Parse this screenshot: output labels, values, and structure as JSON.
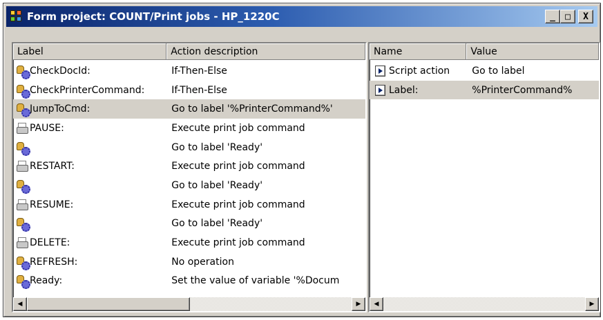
{
  "window": {
    "title": "Form project: COUNT/Print jobs - HP_1220C",
    "minimize_label": "_",
    "restore_label": "□",
    "close_label": "X"
  },
  "left_table": {
    "columns": [
      "Label",
      "Action description"
    ],
    "rows": [
      {
        "icon": "gear-person-icon",
        "label": "CheckDocId:",
        "action": "If-Then-Else"
      },
      {
        "icon": "gear-person-icon",
        "label": "CheckPrinterCommand:",
        "action": "If-Then-Else"
      },
      {
        "icon": "gear-person-icon",
        "label": "JumpToCmd:",
        "action": "Go to label '%PrinterCommand%'",
        "selected": true
      },
      {
        "icon": "printer-icon",
        "label": "PAUSE:",
        "action": "Execute print job command"
      },
      {
        "icon": "gear-person-icon",
        "label": "",
        "action": "Go to label 'Ready'"
      },
      {
        "icon": "printer-icon",
        "label": "RESTART:",
        "action": "Execute print job command"
      },
      {
        "icon": "gear-person-icon",
        "label": "",
        "action": "Go to label 'Ready'"
      },
      {
        "icon": "printer-icon",
        "label": "RESUME:",
        "action": "Execute print job command"
      },
      {
        "icon": "gear-person-icon",
        "label": "",
        "action": "Go to label 'Ready'"
      },
      {
        "icon": "printer-icon",
        "label": "DELETE:",
        "action": "Execute print job command"
      },
      {
        "icon": "gear-person-icon",
        "label": "REFRESH:",
        "action": "No operation"
      },
      {
        "icon": "gear-person-icon",
        "label": "Ready:",
        "action": "Set the value of variable '%Docum"
      }
    ]
  },
  "right_table": {
    "columns": [
      "Name",
      "Value"
    ],
    "rows": [
      {
        "icon": "script-icon",
        "name": "Script action",
        "value": "Go to label"
      },
      {
        "icon": "script-icon",
        "name": "Label:",
        "value": "%PrinterCommand%",
        "selected": true
      }
    ]
  },
  "scroll": {
    "left_arrow": "◀",
    "right_arrow": "▶"
  }
}
